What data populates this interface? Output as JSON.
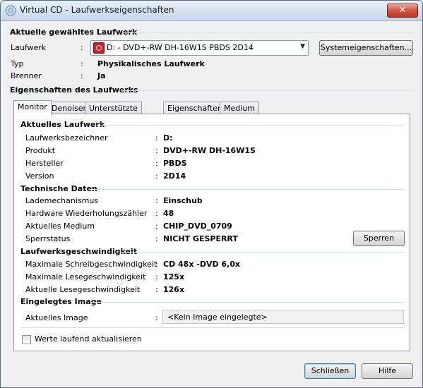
{
  "window": {
    "title": "Virtual CD - Laufwerkseigenschaften",
    "close_label": "✕"
  },
  "drive_section": {
    "header": "Aktuelle gewähltes Laufwerk",
    "drive_label": "Laufwerk",
    "drive_value": "D: - DVD+-RW DH-16W1S PBDS 2D14",
    "system_button": "Systemeigenschaften...",
    "type_label": "Typ",
    "type_value": "Physikalisches Laufwerk",
    "burner_label": "Brenner",
    "burner_value": "Ja"
  },
  "properties_header": "Eigenschaften des Laufwerks",
  "tabs": [
    "Monitor",
    "Denoiser",
    "Unterstützte Medien",
    "Eigenschaften",
    "Medium"
  ],
  "monitor": {
    "current_drive": {
      "header": "Aktuelles Laufwerk",
      "rows": [
        {
          "label": "Laufwerksbezeichner",
          "value": "D:"
        },
        {
          "label": "Produkt",
          "value": "DVD+-RW DH-16W1S"
        },
        {
          "label": "Hersteller",
          "value": "PBDS"
        },
        {
          "label": "Version",
          "value": "2D14"
        }
      ]
    },
    "tech": {
      "header": "Technische Daten",
      "rows": [
        {
          "label": "Lademechanismus",
          "value": "Einschub"
        },
        {
          "label": "Hardware Wiederholungszähler",
          "value": "48"
        },
        {
          "label": "Aktuelles Medium",
          "value": "CHIP_DVD_0709"
        },
        {
          "label": "Sperrstatus",
          "value": "NICHT GESPERRT"
        }
      ],
      "lock_button": "Sperren"
    },
    "speed": {
      "header": "Laufwerksgeschwindigkeit",
      "rows": [
        {
          "label": "Maximale Schreibgeschwindigkeit",
          "value": "CD 48x -DVD 6,0x"
        },
        {
          "label": "Maximale Lesegeschwindigkeit",
          "value": "125x"
        },
        {
          "label": "Aktuelle Lesegeschwindigkeit",
          "value": "126x"
        }
      ]
    },
    "image": {
      "header": "Eingelegtes Image",
      "label": "Aktuelles Image",
      "value": "<Kein Image eingelegte>"
    },
    "refresh_checkbox": "Werte laufend aktualisieren"
  },
  "footer": {
    "close_button": "Schließen",
    "help_button": "Hilfe"
  },
  "colon": ":"
}
